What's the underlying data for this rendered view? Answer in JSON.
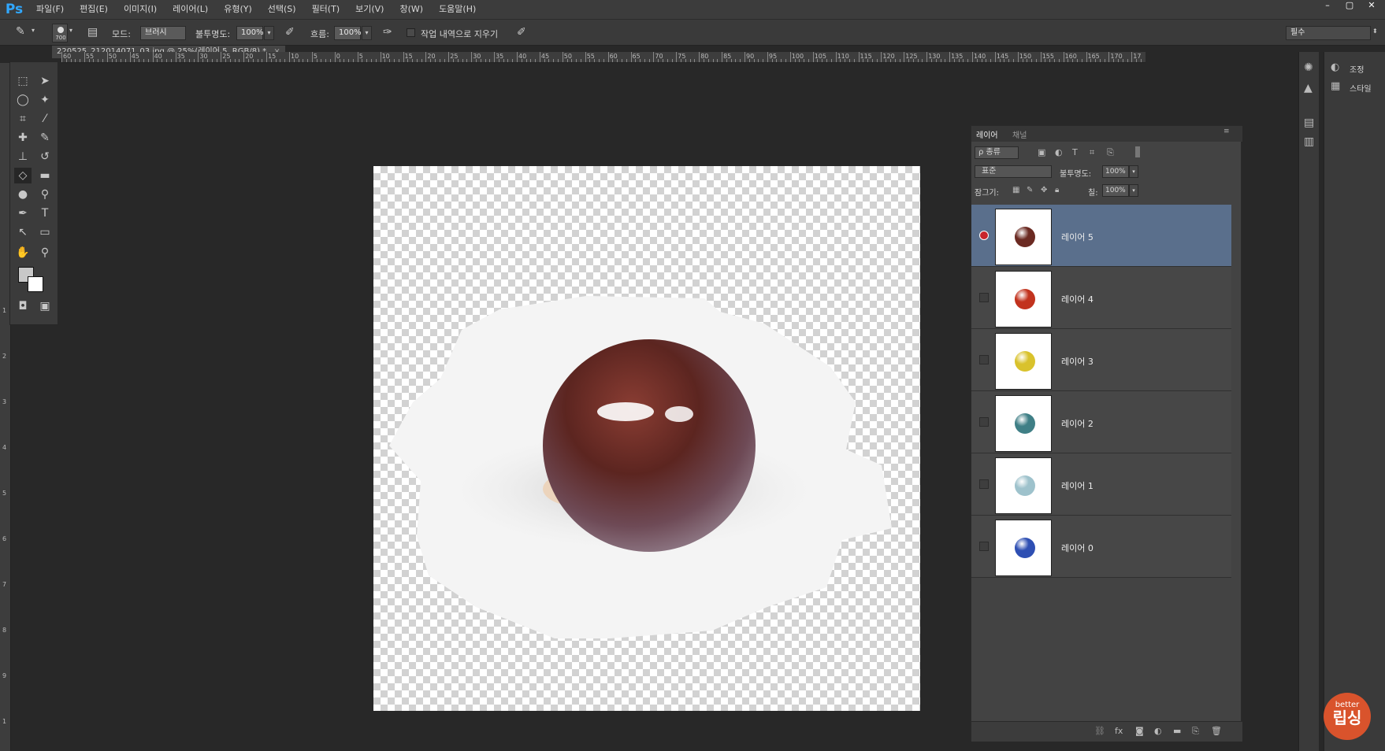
{
  "app": {
    "logo": "Ps"
  },
  "menu": [
    "파일(F)",
    "편집(E)",
    "이미지(I)",
    "레이어(L)",
    "유형(Y)",
    "선택(S)",
    "필터(T)",
    "보기(V)",
    "창(W)",
    "도움말(H)"
  ],
  "window_controls": {
    "minimize": "–",
    "restore": "▢",
    "close": "✕"
  },
  "options": {
    "brush_size": "700",
    "mode_label": "모드:",
    "mode_value": "브러시",
    "opacity_label": "불투명도:",
    "opacity_value": "100%",
    "flow_label": "흐름:",
    "flow_value": "100%",
    "erase_history_label": "작업 내역으로 지우기",
    "workspace_value": "필수"
  },
  "document": {
    "tab_title": "220525_212014071_03.jpg @ 25%(레이어 5, RGB/8) *"
  },
  "rulers": {
    "h_labels": [
      "60",
      "55",
      "50",
      "45",
      "40",
      "35",
      "30",
      "25",
      "20",
      "15",
      "10",
      "5",
      "0",
      "5",
      "10",
      "15",
      "20",
      "25",
      "30",
      "35",
      "40",
      "45",
      "50",
      "55",
      "60",
      "65",
      "70",
      "75",
      "80",
      "85",
      "90",
      "95",
      "100",
      "105",
      "110",
      "115",
      "120",
      "125",
      "130",
      "135",
      "140",
      "145",
      "150",
      "155",
      "160",
      "165",
      "170",
      "17"
    ],
    "v_labels": [
      "1",
      "2",
      "3",
      "4",
      "5",
      "6",
      "7",
      "8",
      "9",
      "1"
    ]
  },
  "right_panel": {
    "adjust_label": "조정",
    "styles_label": "스타일"
  },
  "layers_panel": {
    "tabs": [
      "레이어",
      "채널"
    ],
    "filter_label": "ρ 종류",
    "blend_mode": "표준",
    "opacity_label": "불투명도:",
    "opacity_value": "100%",
    "lock_label": "잠그기:",
    "fill_label": "칠:",
    "fill_value": "100%",
    "layers": [
      {
        "name": "레이어 5",
        "selected": true,
        "marble_color": "#6b2a22"
      },
      {
        "name": "레이어 4",
        "selected": false,
        "marble_color": "#c2331e"
      },
      {
        "name": "레이어 3",
        "selected": false,
        "marble_color": "#d9c22c"
      },
      {
        "name": "레이어 2",
        "selected": false,
        "marble_color": "#3f7f86"
      },
      {
        "name": "레이어 1",
        "selected": false,
        "marble_color": "#9ec2cc"
      },
      {
        "name": "레이어 0",
        "selected": false,
        "marble_color": "#2e4fb3"
      }
    ],
    "footer_icons": [
      "link-icon",
      "fx-icon",
      "mask-icon",
      "adjustment-icon",
      "folder-icon",
      "new-layer-icon",
      "trash-icon"
    ]
  },
  "badge": {
    "top": "better",
    "bottom": "립싱"
  },
  "colors": {
    "selected_layer": "#5a6f8c",
    "ps_blue": "#31a8ff",
    "badge": "#d9532c"
  }
}
